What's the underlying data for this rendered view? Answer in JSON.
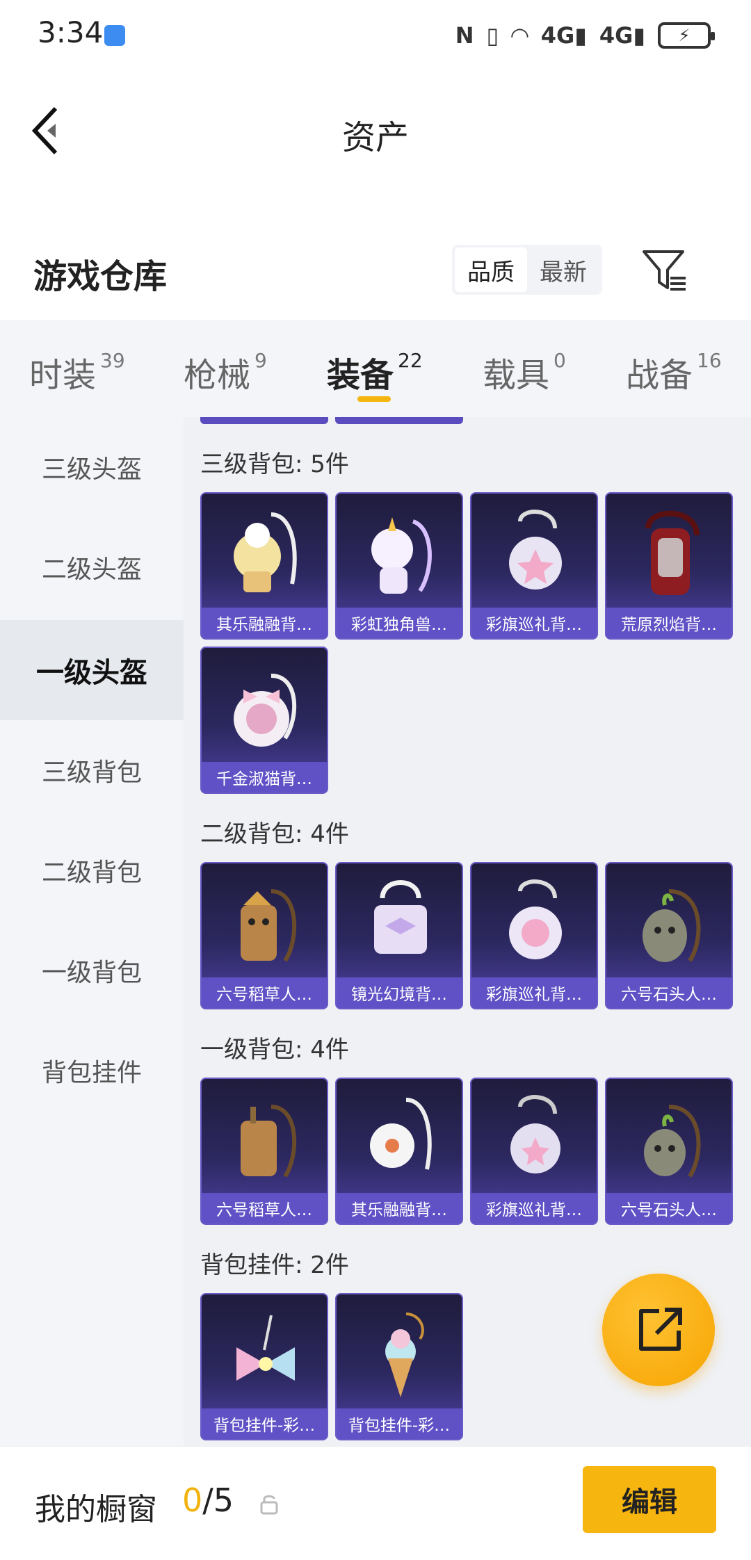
{
  "status_bar": {
    "time": "3:34",
    "network_1": "4G",
    "network_2": "4G"
  },
  "header": {
    "title": "资产",
    "back_icon": "chevron-left-icon"
  },
  "warehouse": {
    "title": "游戏仓库",
    "sort_options": [
      "品质",
      "最新"
    ],
    "active_sort": "品质",
    "filter_icon": "filter-icon"
  },
  "tabs": [
    {
      "label": "时装",
      "count": "39"
    },
    {
      "label": "枪械",
      "count": "9"
    },
    {
      "label": "装备",
      "count": "22"
    },
    {
      "label": "载具",
      "count": "0"
    },
    {
      "label": "战备",
      "count": "16"
    }
  ],
  "active_tab": "装备",
  "sidebar": {
    "items": [
      "三级头盔",
      "二级头盔",
      "一级头盔",
      "三级背包",
      "二级背包",
      "一级背包",
      "背包挂件"
    ],
    "active": "一级头盔"
  },
  "sections": [
    {
      "title": "三级背包: 5件",
      "items": [
        "其乐融融背…",
        "彩虹独角兽…",
        "彩旗巡礼背…",
        "荒原烈焰背…",
        "千金淑猫背…"
      ]
    },
    {
      "title": "二级背包: 4件",
      "items": [
        "六号稻草人…",
        "镜光幻境背…",
        "彩旗巡礼背…",
        "六号石头人…"
      ]
    },
    {
      "title": "一级背包: 4件",
      "items": [
        "六号稻草人…",
        "其乐融融背…",
        "彩旗巡礼背…",
        "六号石头人…"
      ]
    },
    {
      "title": "背包挂件: 2件",
      "items": [
        "背包挂件-彩…",
        "背包挂件-彩…"
      ]
    }
  ],
  "fab": {
    "icon": "share-icon"
  },
  "bottom": {
    "showcase_label": "我的橱窗",
    "showcase_current": "0",
    "showcase_total": "/5",
    "lock_icon": "lock-icon",
    "edit_label": "编辑"
  },
  "colors": {
    "accent": "#f7b50f",
    "card_label": "#6252c8",
    "card_bg": "#2c2860"
  }
}
